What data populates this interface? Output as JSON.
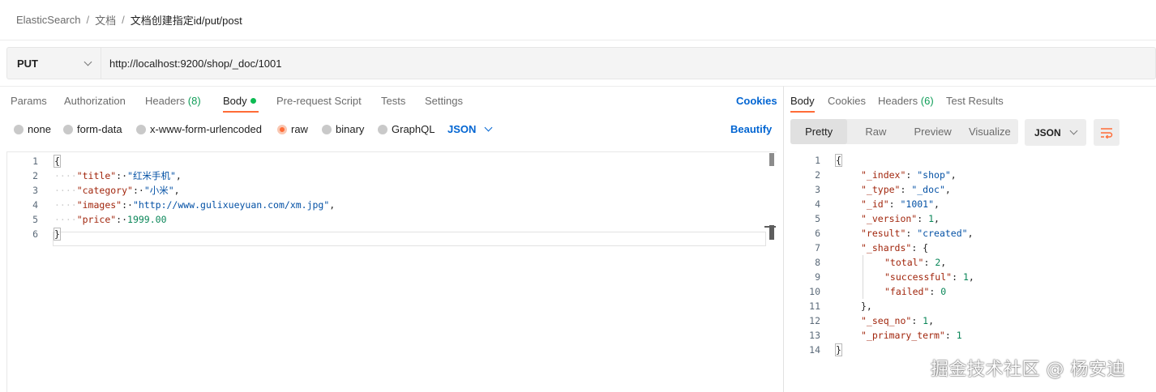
{
  "breadcrumb": {
    "items": [
      "ElasticSearch",
      "文档"
    ],
    "separator": "/",
    "current": "文档创建指定id/put/post"
  },
  "request": {
    "method": "PUT",
    "url": "http://localhost:9200/shop/_doc/1001"
  },
  "request_tabs": {
    "params": "Params",
    "authorization": "Authorization",
    "headers": "Headers",
    "headers_count": "(8)",
    "body": "Body",
    "prerequest": "Pre-request Script",
    "tests": "Tests",
    "settings": "Settings",
    "cookies": "Cookies"
  },
  "body_types": {
    "none": "none",
    "form_data": "form-data",
    "urlencoded": "x-www-form-urlencoded",
    "raw": "raw",
    "binary": "binary",
    "graphql": "GraphQL",
    "language": "JSON",
    "beautify": "Beautify"
  },
  "request_body": {
    "line_numbers": [
      "1",
      "2",
      "3",
      "4",
      "5",
      "6"
    ],
    "open": "{",
    "close": "}",
    "fields": [
      {
        "key": "\"title\"",
        "value": "\"红米手机\"",
        "trail": ","
      },
      {
        "key": "\"category\"",
        "value": "\"小米\"",
        "trail": ","
      },
      {
        "key": "\"images\"",
        "value": "\"http://www.gulixueyuan.com/xm.jpg\"",
        "trail": ","
      },
      {
        "key": "\"price\"",
        "value": "1999.00",
        "trail": ""
      }
    ]
  },
  "response_tabs": {
    "body": "Body",
    "cookies": "Cookies",
    "headers": "Headers",
    "headers_count": "(6)",
    "test_results": "Test Results"
  },
  "response_view": {
    "pretty": "Pretty",
    "raw": "Raw",
    "preview": "Preview",
    "visualize": "Visualize",
    "format": "JSON"
  },
  "response_body": {
    "line_numbers": [
      "1",
      "2",
      "3",
      "4",
      "5",
      "6",
      "7",
      "8",
      "9",
      "10",
      "11",
      "12",
      "13",
      "14"
    ],
    "open": "{",
    "close": "}",
    "index_key": "\"_index\"",
    "index_val": "\"shop\"",
    "type_key": "\"_type\"",
    "type_val": "\"_doc\"",
    "id_key": "\"_id\"",
    "id_val": "\"1001\"",
    "version_key": "\"_version\"",
    "version_val": "1",
    "result_key": "\"result\"",
    "result_val": "\"created\"",
    "shards_key": "\"_shards\"",
    "shards_open": "{",
    "total_key": "\"total\"",
    "total_val": "2",
    "successful_key": "\"successful\"",
    "successful_val": "1",
    "failed_key": "\"failed\"",
    "failed_val": "0",
    "shards_close": "},",
    "seq_key": "\"_seq_no\"",
    "seq_val": "1",
    "term_key": "\"_primary_term\"",
    "term_val": "1"
  },
  "watermark": "掘金技术社区 @ 杨安迪",
  "colors": {
    "accent": "#ff6c37",
    "link": "#0265d2",
    "key": "#a1260d",
    "string": "#0451a5",
    "number": "#098658",
    "count_green": "#0f9d58"
  }
}
